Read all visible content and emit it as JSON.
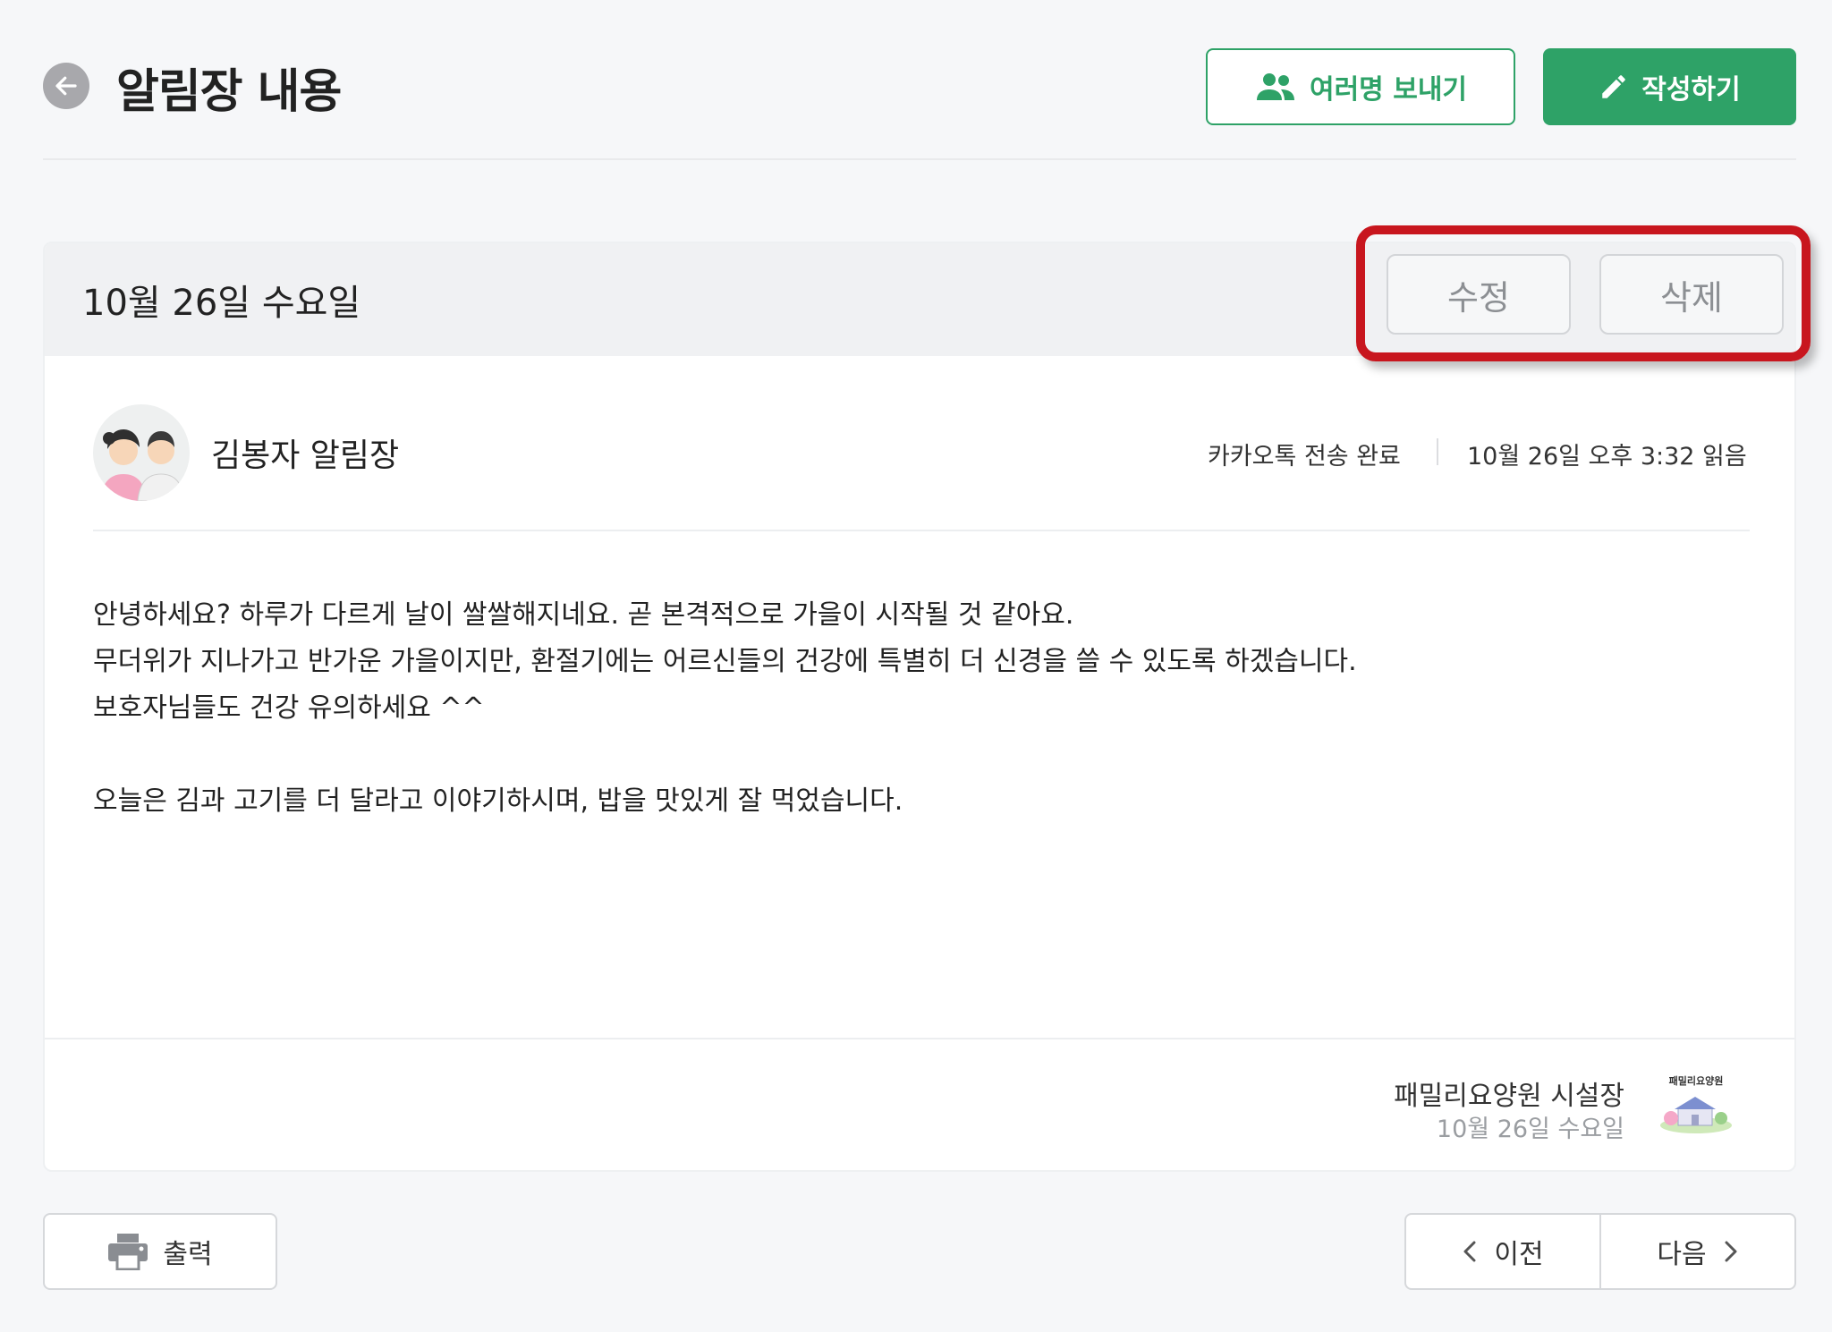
{
  "header": {
    "title": "알림장 내용",
    "multi_send_label": "여러명 보내기",
    "write_label": "작성하기"
  },
  "notice": {
    "date": "10월 26일 수요일",
    "edit_label": "수정",
    "delete_label": "삭제",
    "sender": "김봉자 알림장",
    "status": "카카오톡 전송 완료",
    "read_time": "10월 26일 오후 3:32 읽음",
    "message_lines": [
      "안녕하세요? 하루가 다르게 날이 쌀쌀해지네요. 곧 본격적으로 가을이 시작될 것 같아요.",
      "무더위가 지나가고 반가운 가을이지만, 환절기에는 어르신들의 건강에 특별히 더 신경을 쓸 수 있도록 하겠습니다.",
      "보호자님들도 건강 유의하세요 ^^",
      "오늘은 김과 고기를 더 달라고 이야기하시며, 밥을 맛있게 잘 먹었습니다."
    ],
    "facility_name": "패밀리요양원 시설장",
    "facility_date": "10월 26일 수요일",
    "facility_logo_text": "패밀리요양원"
  },
  "footer": {
    "print_label": "출력",
    "prev_label": "이전",
    "next_label": "다음"
  },
  "colors": {
    "accent": "#2ea267",
    "highlight": "#c8161e"
  }
}
